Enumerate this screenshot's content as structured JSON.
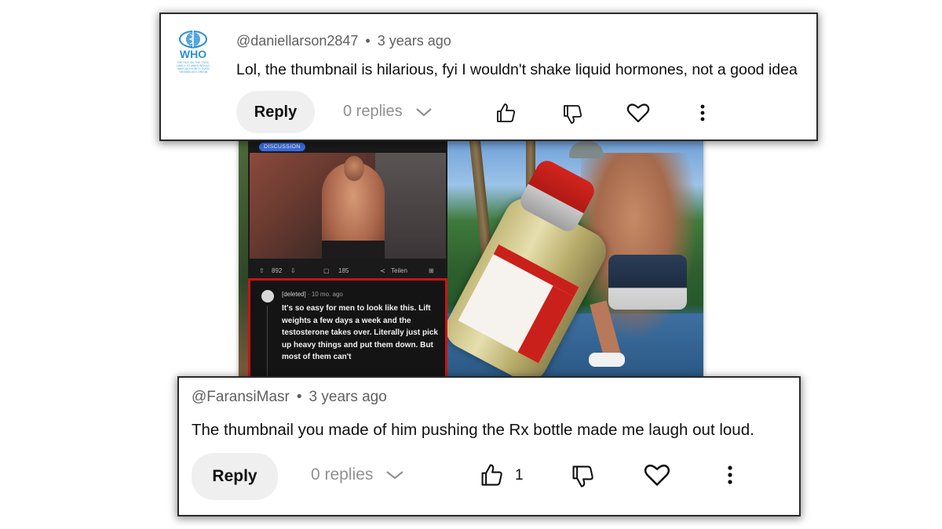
{
  "comment1": {
    "author": "@daniellarson2847",
    "separator": "•",
    "time": "3 years ago",
    "text": "Lol, the thumbnail is hilarious, fyi I wouldn't shake liquid hormones, not a good idea",
    "reply_label": "Reply",
    "replies_label": "0 replies",
    "avatar_logo_text": "WHO",
    "avatar_logo_caption": "THE FILE ON THE TOPIC LIKELY TO MAKE WOULD HAVE AUTHORITY OVER THEMSELVES ORIGIN",
    "icons": [
      "who-logo",
      "chevron-down-icon",
      "thumbs-up-icon",
      "thumbs-down-icon",
      "heart-icon",
      "more-vertical-icon"
    ],
    "colors": {
      "logo": "#2a8fd6"
    }
  },
  "thumbnail": {
    "tag": "DISCUSSION",
    "upvotes": "892",
    "comments": "185",
    "share": "Teilen",
    "comment_author": "[deleted]",
    "comment_time": "10 mo. ago",
    "comment_text": "It's so easy for men to look like this. Lift weights a few days a week and the testosterone takes over. Literally just pick up heavy things and put them down. But most of them can't",
    "colors": {
      "highlight": "#c81414",
      "tag": "#3a6ee0",
      "bottle_label": "#c9201b"
    }
  },
  "comment2": {
    "author": "@FaransiMasr",
    "separator": "•",
    "time": "3 years ago",
    "text": "The thumbnail you made of him pushing the Rx bottle made me laugh out loud.",
    "reply_label": "Reply",
    "replies_label": "0 replies",
    "like_count": "1",
    "icons": [
      "chevron-down-icon",
      "thumbs-up-icon",
      "thumbs-down-icon",
      "heart-icon",
      "more-vertical-icon"
    ]
  }
}
